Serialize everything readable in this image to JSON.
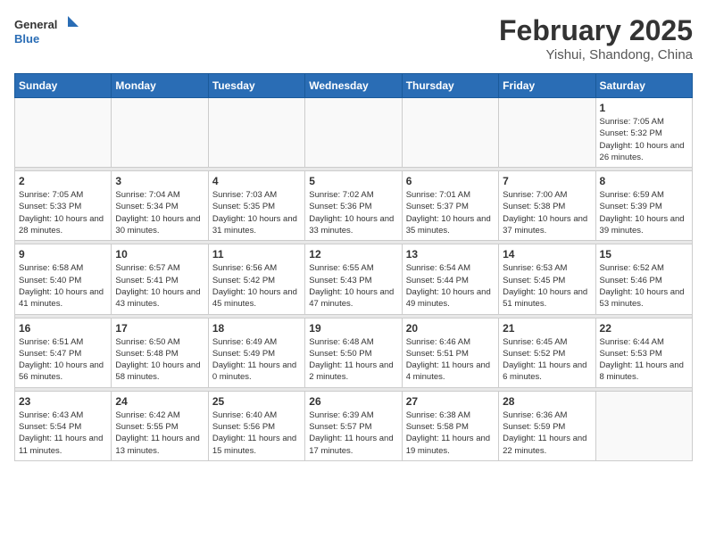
{
  "header": {
    "logo_general": "General",
    "logo_blue": "Blue",
    "month_year": "February 2025",
    "location": "Yishui, Shandong, China"
  },
  "days_of_week": [
    "Sunday",
    "Monday",
    "Tuesday",
    "Wednesday",
    "Thursday",
    "Friday",
    "Saturday"
  ],
  "weeks": [
    {
      "days": [
        {
          "num": "",
          "info": "",
          "empty": true
        },
        {
          "num": "",
          "info": "",
          "empty": true
        },
        {
          "num": "",
          "info": "",
          "empty": true
        },
        {
          "num": "",
          "info": "",
          "empty": true
        },
        {
          "num": "",
          "info": "",
          "empty": true
        },
        {
          "num": "",
          "info": "",
          "empty": true
        },
        {
          "num": "1",
          "info": "Sunrise: 7:05 AM\nSunset: 5:32 PM\nDaylight: 10 hours and 26 minutes.",
          "empty": false
        }
      ]
    },
    {
      "days": [
        {
          "num": "2",
          "info": "Sunrise: 7:05 AM\nSunset: 5:33 PM\nDaylight: 10 hours and 28 minutes.",
          "empty": false
        },
        {
          "num": "3",
          "info": "Sunrise: 7:04 AM\nSunset: 5:34 PM\nDaylight: 10 hours and 30 minutes.",
          "empty": false
        },
        {
          "num": "4",
          "info": "Sunrise: 7:03 AM\nSunset: 5:35 PM\nDaylight: 10 hours and 31 minutes.",
          "empty": false
        },
        {
          "num": "5",
          "info": "Sunrise: 7:02 AM\nSunset: 5:36 PM\nDaylight: 10 hours and 33 minutes.",
          "empty": false
        },
        {
          "num": "6",
          "info": "Sunrise: 7:01 AM\nSunset: 5:37 PM\nDaylight: 10 hours and 35 minutes.",
          "empty": false
        },
        {
          "num": "7",
          "info": "Sunrise: 7:00 AM\nSunset: 5:38 PM\nDaylight: 10 hours and 37 minutes.",
          "empty": false
        },
        {
          "num": "8",
          "info": "Sunrise: 6:59 AM\nSunset: 5:39 PM\nDaylight: 10 hours and 39 minutes.",
          "empty": false
        }
      ]
    },
    {
      "days": [
        {
          "num": "9",
          "info": "Sunrise: 6:58 AM\nSunset: 5:40 PM\nDaylight: 10 hours and 41 minutes.",
          "empty": false
        },
        {
          "num": "10",
          "info": "Sunrise: 6:57 AM\nSunset: 5:41 PM\nDaylight: 10 hours and 43 minutes.",
          "empty": false
        },
        {
          "num": "11",
          "info": "Sunrise: 6:56 AM\nSunset: 5:42 PM\nDaylight: 10 hours and 45 minutes.",
          "empty": false
        },
        {
          "num": "12",
          "info": "Sunrise: 6:55 AM\nSunset: 5:43 PM\nDaylight: 10 hours and 47 minutes.",
          "empty": false
        },
        {
          "num": "13",
          "info": "Sunrise: 6:54 AM\nSunset: 5:44 PM\nDaylight: 10 hours and 49 minutes.",
          "empty": false
        },
        {
          "num": "14",
          "info": "Sunrise: 6:53 AM\nSunset: 5:45 PM\nDaylight: 10 hours and 51 minutes.",
          "empty": false
        },
        {
          "num": "15",
          "info": "Sunrise: 6:52 AM\nSunset: 5:46 PM\nDaylight: 10 hours and 53 minutes.",
          "empty": false
        }
      ]
    },
    {
      "days": [
        {
          "num": "16",
          "info": "Sunrise: 6:51 AM\nSunset: 5:47 PM\nDaylight: 10 hours and 56 minutes.",
          "empty": false
        },
        {
          "num": "17",
          "info": "Sunrise: 6:50 AM\nSunset: 5:48 PM\nDaylight: 10 hours and 58 minutes.",
          "empty": false
        },
        {
          "num": "18",
          "info": "Sunrise: 6:49 AM\nSunset: 5:49 PM\nDaylight: 11 hours and 0 minutes.",
          "empty": false
        },
        {
          "num": "19",
          "info": "Sunrise: 6:48 AM\nSunset: 5:50 PM\nDaylight: 11 hours and 2 minutes.",
          "empty": false
        },
        {
          "num": "20",
          "info": "Sunrise: 6:46 AM\nSunset: 5:51 PM\nDaylight: 11 hours and 4 minutes.",
          "empty": false
        },
        {
          "num": "21",
          "info": "Sunrise: 6:45 AM\nSunset: 5:52 PM\nDaylight: 11 hours and 6 minutes.",
          "empty": false
        },
        {
          "num": "22",
          "info": "Sunrise: 6:44 AM\nSunset: 5:53 PM\nDaylight: 11 hours and 8 minutes.",
          "empty": false
        }
      ]
    },
    {
      "days": [
        {
          "num": "23",
          "info": "Sunrise: 6:43 AM\nSunset: 5:54 PM\nDaylight: 11 hours and 11 minutes.",
          "empty": false
        },
        {
          "num": "24",
          "info": "Sunrise: 6:42 AM\nSunset: 5:55 PM\nDaylight: 11 hours and 13 minutes.",
          "empty": false
        },
        {
          "num": "25",
          "info": "Sunrise: 6:40 AM\nSunset: 5:56 PM\nDaylight: 11 hours and 15 minutes.",
          "empty": false
        },
        {
          "num": "26",
          "info": "Sunrise: 6:39 AM\nSunset: 5:57 PM\nDaylight: 11 hours and 17 minutes.",
          "empty": false
        },
        {
          "num": "27",
          "info": "Sunrise: 6:38 AM\nSunset: 5:58 PM\nDaylight: 11 hours and 19 minutes.",
          "empty": false
        },
        {
          "num": "28",
          "info": "Sunrise: 6:36 AM\nSunset: 5:59 PM\nDaylight: 11 hours and 22 minutes.",
          "empty": false
        },
        {
          "num": "",
          "info": "",
          "empty": true
        }
      ]
    }
  ]
}
